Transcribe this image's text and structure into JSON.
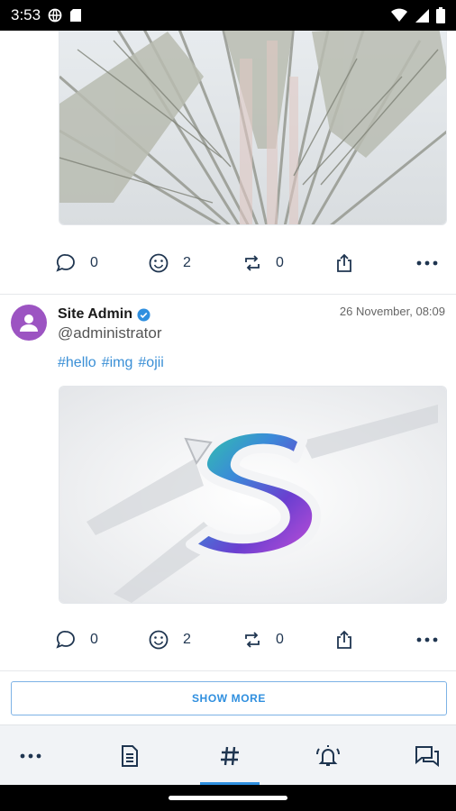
{
  "status_bar": {
    "time": "3:53"
  },
  "post1": {
    "image_alt": "palm fronds photo",
    "actions": {
      "comments": "0",
      "reactions": "2",
      "reposts": "0"
    }
  },
  "post2": {
    "author": "Site Admin",
    "handle": "@administrator",
    "date": "26 November, 08:09",
    "hashtags": [
      "#hello",
      "#img",
      "#ojii"
    ],
    "image_alt": "S logo",
    "actions": {
      "comments": "0",
      "reactions": "2",
      "reposts": "0"
    }
  },
  "show_more_label": "SHOW MORE",
  "colors": {
    "accent": "#2f8fdf",
    "avatar": "#9c54c2",
    "icon": "#1f3550"
  }
}
